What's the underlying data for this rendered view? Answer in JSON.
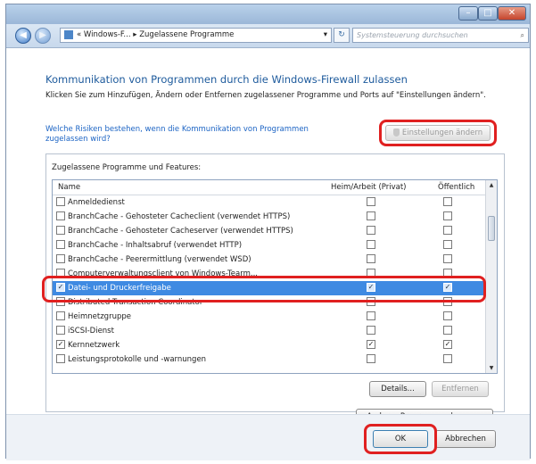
{
  "window": {
    "controls": {
      "minimize": "–",
      "maximize": "□",
      "close": "✕"
    }
  },
  "navbar": {
    "back": "◀",
    "forward": "▶",
    "breadcrumb": "« Windows-F... ▸ Zugelassene Programme",
    "dropdown": "▾",
    "refresh": "↻",
    "search_placeholder": "Systemsteuerung durchsuchen",
    "search_icon": "⌕"
  },
  "content": {
    "heading": "Kommunikation von Programmen durch die Windows-Firewall zulassen",
    "description": "Klicken Sie zum Hinzufügen, Ändern oder Entfernen zugelassener Programme und Ports auf \"Einstellungen ändern\".",
    "risk_link": "Welche Risiken bestehen, wenn die Kommunikation von Programmen zugelassen wird?",
    "change_settings_button": "Einstellungen ändern",
    "group_label": "Zugelassene Programme und Features:",
    "columns": {
      "name": "Name",
      "home": "Heim/Arbeit (Privat)",
      "public": "Öffentlich"
    },
    "rows": [
      {
        "name": "Anmeldedienst",
        "enabled": false,
        "home": false,
        "public": false,
        "selected": false
      },
      {
        "name": "BranchCache - Gehosteter Cacheclient (verwendet HTTPS)",
        "enabled": false,
        "home": false,
        "public": false,
        "selected": false
      },
      {
        "name": "BranchCache - Gehosteter Cacheserver (verwendet HTTPS)",
        "enabled": false,
        "home": false,
        "public": false,
        "selected": false
      },
      {
        "name": "BranchCache - Inhaltsabruf (verwendet HTTP)",
        "enabled": false,
        "home": false,
        "public": false,
        "selected": false
      },
      {
        "name": "BranchCache - Peerermittlung (verwendet WSD)",
        "enabled": false,
        "home": false,
        "public": false,
        "selected": false
      },
      {
        "name": "Computerverwaltungsclient von Windows-Tearm...",
        "enabled": false,
        "home": false,
        "public": false,
        "selected": false
      },
      {
        "name": "Datei- und Druckerfreigabe",
        "enabled": true,
        "home": true,
        "public": true,
        "selected": true
      },
      {
        "name": "Distributed Transaction Coordinator",
        "enabled": false,
        "home": false,
        "public": false,
        "selected": false
      },
      {
        "name": "Heimnetzgruppe",
        "enabled": false,
        "home": false,
        "public": false,
        "selected": false
      },
      {
        "name": "iSCSI-Dienst",
        "enabled": false,
        "home": false,
        "public": false,
        "selected": false
      },
      {
        "name": "Kernnetzwerk",
        "enabled": true,
        "home": true,
        "public": true,
        "selected": false
      },
      {
        "name": "Leistungsprotokolle und -warnungen",
        "enabled": false,
        "home": false,
        "public": false,
        "selected": false
      }
    ],
    "details_button": "Details...",
    "remove_button": "Entfernen",
    "allow_other_button": "Anderes Programm zulassen..."
  },
  "footer": {
    "ok_button": "OK",
    "cancel_button": "Abbrechen"
  },
  "colors": {
    "highlight": "#e02020",
    "selection": "#3f8ae2",
    "heading": "#1d5a9c",
    "link": "#1c64c4"
  },
  "icons": {
    "shield": "shield-icon",
    "folder": "control-panel-icon",
    "search": "search-icon"
  }
}
